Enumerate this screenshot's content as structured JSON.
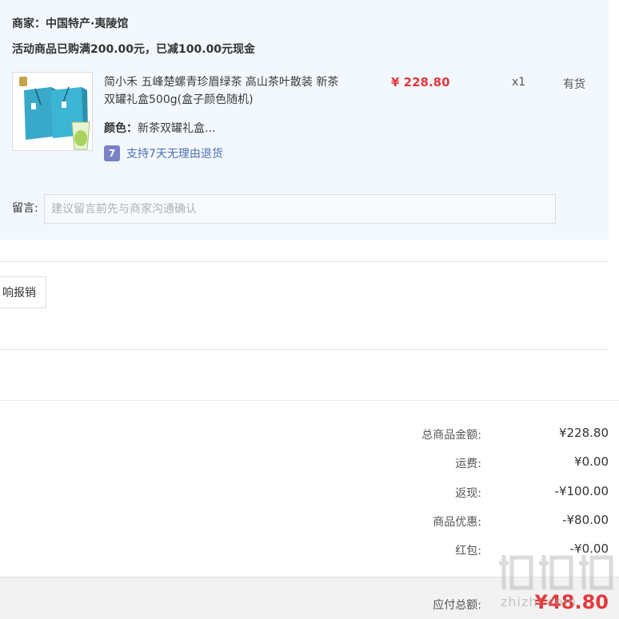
{
  "order": {
    "merchant": "商家：中国特产·夷陵馆",
    "promo": "活动商品已购满200.00元，已减100.00元现金",
    "item": {
      "title": "简小禾 五峰楚螺青珍眉绿茶 高山茶叶散装 新茶双罐礼盒500g(盒子颜色随机)",
      "color_label": "颜色：",
      "color_value": "新茶双罐礼盒...",
      "guarantee_badge": "7",
      "guarantee_text": "支持7天无理由退货",
      "price": "¥ 228.80",
      "quantity": "x1",
      "stock": "有货",
      "thumbnail_icon": "tea-gift-box-image"
    },
    "memo": {
      "label": "留言:",
      "placeholder": "建议留言前先与商家沟通确认"
    }
  },
  "invoice": {
    "button_label": "响报销"
  },
  "summary": {
    "rows": [
      {
        "label": "总商品金额:",
        "value": "¥228.80"
      },
      {
        "label": "运费:",
        "value": "¥0.00"
      },
      {
        "label": "返现:",
        "value": "-¥100.00"
      },
      {
        "label": "商品优惠:",
        "value": "-¥80.00"
      },
      {
        "label": "红包:",
        "value": "-¥0.00"
      }
    ],
    "total_label": "应付总额:",
    "total_value": "¥48.80"
  },
  "watermark": {
    "text": "zhizhi.com"
  },
  "colors": {
    "panel_bg": "#f2f8fd",
    "price_red": "#e4393c",
    "link_blue": "#4d6fb3",
    "badge_purple": "#7a7fc8"
  }
}
